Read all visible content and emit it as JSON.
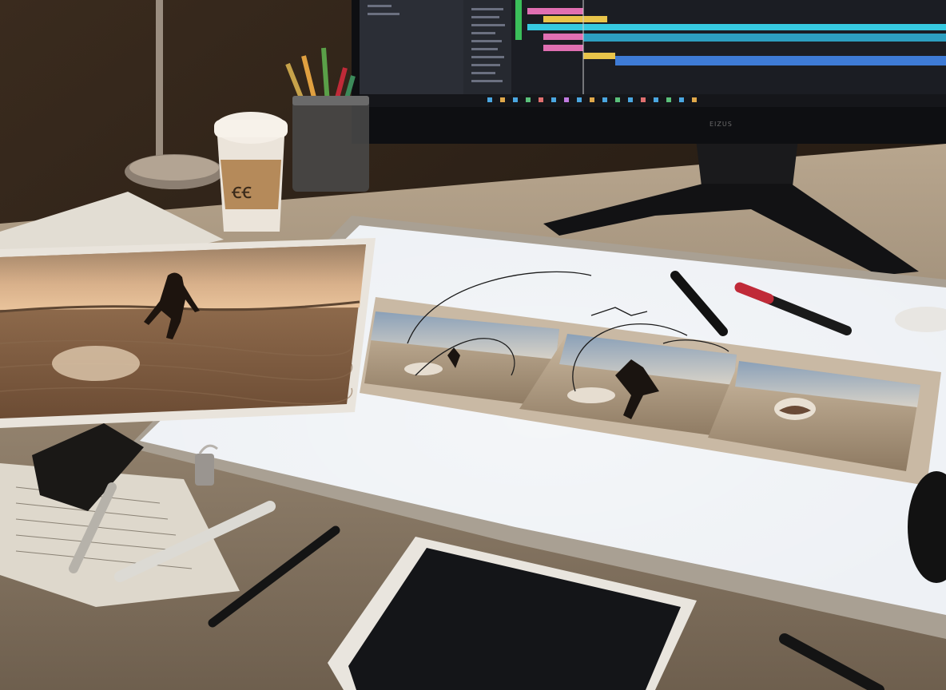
{
  "scene": {
    "description_free": true,
    "monitor": {
      "brand_text": "EIZUS"
    },
    "palette": {
      "wall": "#2a1f17",
      "desk": "#cbbba5",
      "lightbox": "#eef1f5",
      "timeline_cyan": "#36c9e0",
      "timeline_blue": "#3e7bd6",
      "timeline_pink": "#e06fb2",
      "timeline_yellow": "#e8c44a",
      "marker_red": "#c02a38"
    },
    "objects": [
      "desk-lamp",
      "coffee-cup",
      "pen-cup",
      "monitor",
      "light-box",
      "desert-photo-print",
      "storyboard-strip",
      "tablet",
      "markers",
      "papers"
    ]
  }
}
